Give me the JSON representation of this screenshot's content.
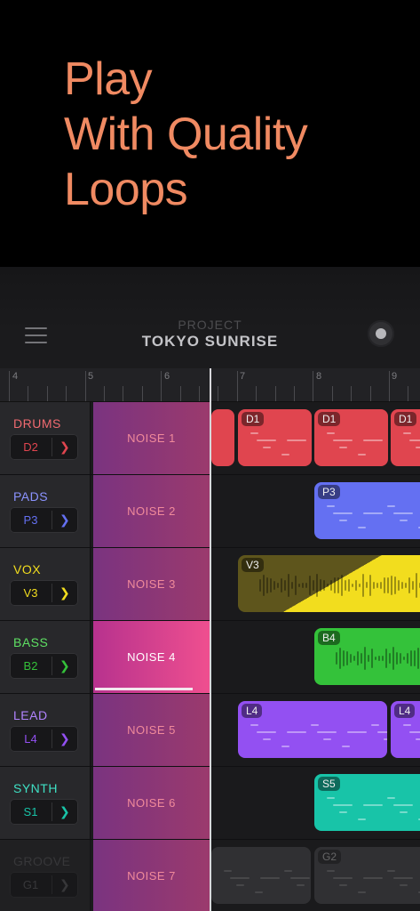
{
  "hero": {
    "line1": "Play",
    "line2": "With Quality",
    "line3": "Loops"
  },
  "header": {
    "project_label": "PROJECT",
    "project_name": "TOKYO SUNRISE"
  },
  "ruler": {
    "marks": [
      "4",
      "5",
      "6",
      "7",
      "8",
      "9"
    ]
  },
  "tracks": [
    {
      "name": "DRUMS",
      "code": "D2",
      "color": "#e0454f",
      "pad": "NOISE 1",
      "clip_tag": "D1"
    },
    {
      "name": "PADS",
      "code": "P3",
      "color": "#6470f2",
      "pad": "NOISE 2",
      "clip_tag": "P3"
    },
    {
      "name": "VOX",
      "code": "V3",
      "color": "#f2dd1e",
      "pad": "NOISE 3",
      "clip_tag": "V3"
    },
    {
      "name": "BASS",
      "code": "B2",
      "color": "#34c23a",
      "pad": "NOISE 4",
      "clip_tag": "B4"
    },
    {
      "name": "LEAD",
      "code": "L4",
      "color": "#9350f2",
      "pad": "NOISE 5",
      "clip_tag": "L4"
    },
    {
      "name": "SYNTH",
      "code": "S1",
      "color": "#18c4a8",
      "pad": "NOISE 6",
      "clip_tag": "S5"
    },
    {
      "name": "GROOVE",
      "code": "G1",
      "color": "#5a5a5e",
      "pad": "NOISE 7",
      "clip_tag": "G2"
    }
  ],
  "active_pad": {
    "name": "NOISE 4",
    "progress": 0.84
  },
  "icons": {
    "menu": "hamburger-menu-icon",
    "record": "record-icon",
    "chevron": "chevron-right-icon"
  }
}
